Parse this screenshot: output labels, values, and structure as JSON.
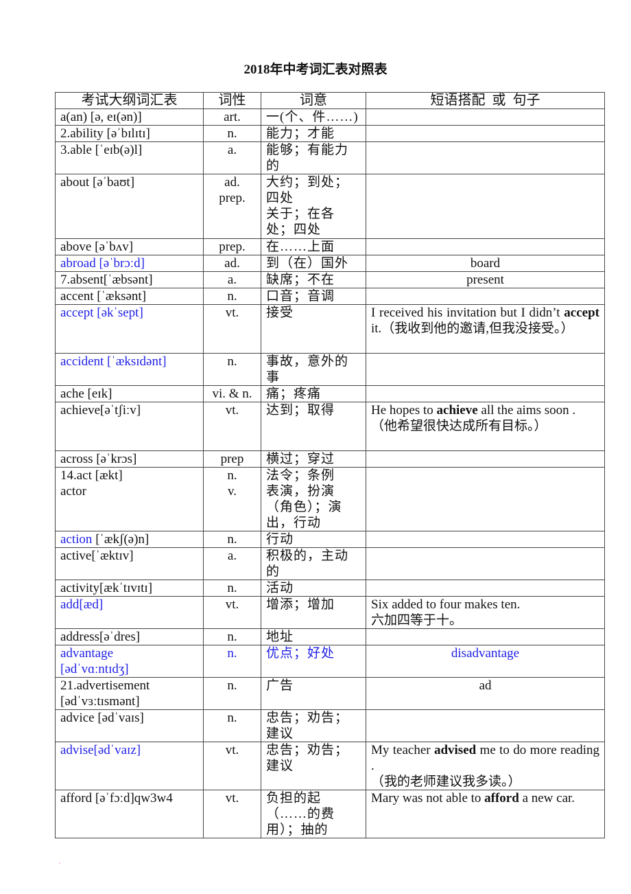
{
  "document": {
    "title": "2018年中考词汇表对照表"
  },
  "table": {
    "headers": [
      "考试大纲词汇表",
      "词性",
      "词意",
      "短语搭配  或  句子"
    ],
    "rows": [
      {
        "word": "a(an) [ə, eɪ(ən)]",
        "pos": "art.",
        "meaning": "一(个、件……)",
        "example": "",
        "highlight": false,
        "height": 24
      },
      {
        "word": "2.ability [əˈbɪlɪtɪ]",
        "pos": "n.",
        "meaning": "能力；才能",
        "example": "",
        "highlight": false,
        "height": 24
      },
      {
        "word": "3.able [ˈeɪb(ə)l]",
        "pos": "a.",
        "meaning": "能够；有能力的",
        "example": "",
        "highlight": false,
        "height": 47
      },
      {
        "word": "about [əˈbaʊt]",
        "pos": "ad.\nprep.",
        "meaning": "大约；到处；四处\n关于；在各处；四处",
        "example": "",
        "highlight": false,
        "height": 94
      },
      {
        "word": "above    [əˈbʌv]",
        "pos": "prep.",
        "meaning": "在……上面",
        "example": "",
        "highlight": false,
        "height": 24
      },
      {
        "word": "abroad    [əˈbrɔːd]",
        "pos": "ad.",
        "meaning": "到（在）国外",
        "example": "board",
        "example_center": true,
        "highlight": true,
        "height": 24
      },
      {
        "word": "7.absent[ˈæbsənt]",
        "pos": "a.",
        "meaning": "缺席；不在",
        "example": "present",
        "example_center": true,
        "highlight": false,
        "height": 24
      },
      {
        "word": "accent [ˈæksənt]",
        "pos": "n.",
        "meaning": "口音；音调",
        "example": "",
        "highlight": false,
        "height": 24
      },
      {
        "word": "accept    [əkˈsept]",
        "pos": "vt.",
        "meaning": "接受",
        "example_parts": [
          {
            "t": "I received his invitation but I didn’t ",
            "b": false
          },
          {
            "t": "accept",
            "b": true
          },
          {
            "t": " it.（我收到他的邀请,但我没接受。）",
            "b": false
          }
        ],
        "highlight": true,
        "height": 71
      },
      {
        "word": "accident [ˈæksɪdənt]",
        "pos": "n.",
        "meaning": "事故，意外的事",
        "example": "",
        "highlight": true,
        "height": 46
      },
      {
        "word": "ache [eɪk]",
        "pos": "vi. & n.",
        "meaning": "痛；疼痛",
        "example": "",
        "highlight": false,
        "height": 24
      },
      {
        "word": "achieve[əˈtʃiːv]",
        "pos": "vt.",
        "meaning": "达到；取得",
        "example_parts": [
          {
            "t": "He hopes to ",
            "b": false
          },
          {
            "t": "achieve",
            "b": true
          },
          {
            "t": " all the aims soon .\n（他希望很快达成所有目标。）",
            "b": false
          }
        ],
        "highlight": false,
        "height": 71
      },
      {
        "word": "across    [əˈkrɔs]",
        "pos": "prep",
        "meaning": "横过；穿过",
        "example": "",
        "highlight": false,
        "height": 24
      },
      {
        "word": "14.act    [ækt]\nactor",
        "pos": "n.\nv.",
        "meaning": "法令；条例\n表演，扮演（角色）；演出，行动",
        "example": "",
        "highlight": false,
        "height": 93
      },
      {
        "word": "action [ˈækʃ(ə)n]",
        "word_blue_part": "action",
        "word_rest": " [ˈækʃ(ə)n]",
        "pos": "n.",
        "meaning": "行动",
        "example": "",
        "highlight": "partial",
        "height": 24
      },
      {
        "word": "active[ˈæktɪv]",
        "pos": "a.",
        "meaning": "积极的，主动的",
        "example": "",
        "highlight": false,
        "height": 47
      },
      {
        "word": "activity[ækˈtɪvɪtɪ]",
        "pos": "n.",
        "meaning": "活动",
        "example": "",
        "highlight": false,
        "height": 24
      },
      {
        "word": "add[æd]",
        "pos": "vt.",
        "meaning": "增添；增加",
        "example": "Six added to four makes ten.\n六加四等于十。",
        "highlight": true,
        "height": 47
      },
      {
        "word": "address[əˈdres]",
        "pos": "n.",
        "meaning": "地址",
        "example": "",
        "highlight": false,
        "height": 24
      },
      {
        "word": "advantage\n[ədˈvɑːntɪdʒ]",
        "pos": "n.",
        "meaning": "优点；好处",
        "example": "disadvantage",
        "example_center": true,
        "highlight": "all",
        "height": 47
      },
      {
        "word": "21.advertisement\n[ədˈvɜːtɪsmənt]",
        "pos": "n.",
        "meaning": "广告",
        "example": "ad",
        "example_center": true,
        "highlight": false,
        "height": 47
      },
      {
        "word": "advice    [ədˈvaɪs]",
        "pos": "n.",
        "meaning": "忠告；劝告；建议",
        "example": "",
        "highlight": false,
        "height": 47
      },
      {
        "word": "advise[ədˈvaɪz]",
        "pos": "vt.",
        "meaning": "忠告；劝告；建议",
        "example_parts": [
          {
            "t": "My teacher ",
            "b": false
          },
          {
            "t": "advised",
            "b": true
          },
          {
            "t": " me to do more reading .\n（我的老师建议我多读。）",
            "b": false
          }
        ],
        "highlight": true,
        "height": 70
      },
      {
        "word": "afford [əˈfɔːd]qw3w4",
        "pos": "vt.",
        "meaning": "负担的起（……的费用）；抽的",
        "example_parts": [
          {
            "t": "Mary was not able to ",
            "b": false
          },
          {
            "t": "afford",
            "b": true
          },
          {
            "t": " a new car.",
            "b": false
          }
        ],
        "highlight": false,
        "height": 47
      }
    ]
  },
  "colors": {
    "highlight_text": "#1f1fe6",
    "border": "#444444",
    "text": "#111111"
  }
}
